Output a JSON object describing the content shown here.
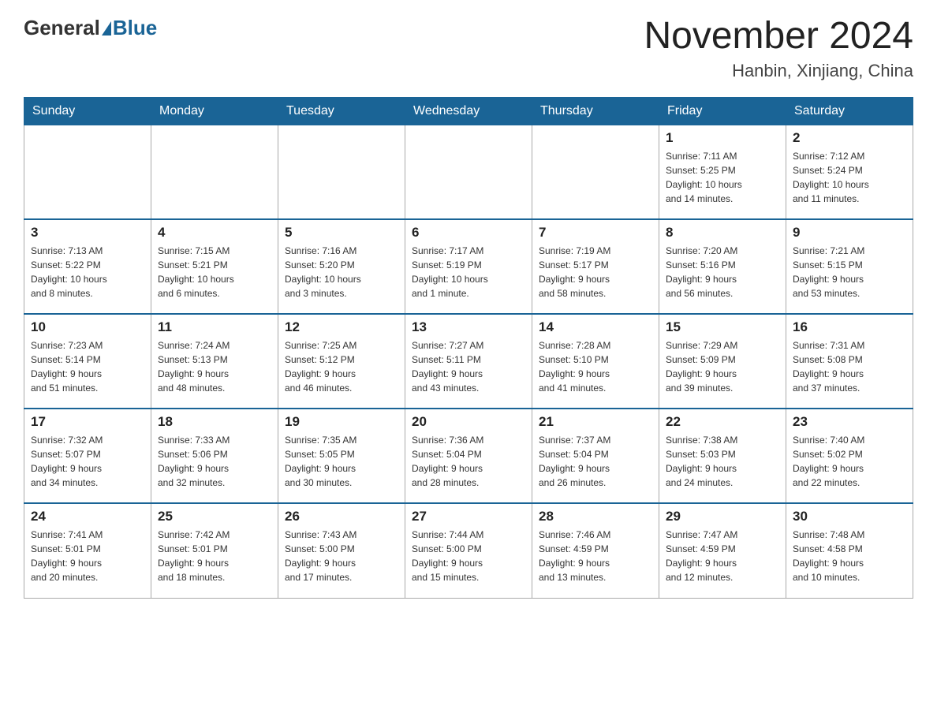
{
  "header": {
    "logo_general": "General",
    "logo_blue": "Blue",
    "month_year": "November 2024",
    "location": "Hanbin, Xinjiang, China"
  },
  "weekdays": [
    "Sunday",
    "Monday",
    "Tuesday",
    "Wednesday",
    "Thursday",
    "Friday",
    "Saturday"
  ],
  "weeks": [
    {
      "days": [
        {
          "num": "",
          "info": ""
        },
        {
          "num": "",
          "info": ""
        },
        {
          "num": "",
          "info": ""
        },
        {
          "num": "",
          "info": ""
        },
        {
          "num": "",
          "info": ""
        },
        {
          "num": "1",
          "info": "Sunrise: 7:11 AM\nSunset: 5:25 PM\nDaylight: 10 hours\nand 14 minutes."
        },
        {
          "num": "2",
          "info": "Sunrise: 7:12 AM\nSunset: 5:24 PM\nDaylight: 10 hours\nand 11 minutes."
        }
      ]
    },
    {
      "days": [
        {
          "num": "3",
          "info": "Sunrise: 7:13 AM\nSunset: 5:22 PM\nDaylight: 10 hours\nand 8 minutes."
        },
        {
          "num": "4",
          "info": "Sunrise: 7:15 AM\nSunset: 5:21 PM\nDaylight: 10 hours\nand 6 minutes."
        },
        {
          "num": "5",
          "info": "Sunrise: 7:16 AM\nSunset: 5:20 PM\nDaylight: 10 hours\nand 3 minutes."
        },
        {
          "num": "6",
          "info": "Sunrise: 7:17 AM\nSunset: 5:19 PM\nDaylight: 10 hours\nand 1 minute."
        },
        {
          "num": "7",
          "info": "Sunrise: 7:19 AM\nSunset: 5:17 PM\nDaylight: 9 hours\nand 58 minutes."
        },
        {
          "num": "8",
          "info": "Sunrise: 7:20 AM\nSunset: 5:16 PM\nDaylight: 9 hours\nand 56 minutes."
        },
        {
          "num": "9",
          "info": "Sunrise: 7:21 AM\nSunset: 5:15 PM\nDaylight: 9 hours\nand 53 minutes."
        }
      ]
    },
    {
      "days": [
        {
          "num": "10",
          "info": "Sunrise: 7:23 AM\nSunset: 5:14 PM\nDaylight: 9 hours\nand 51 minutes."
        },
        {
          "num": "11",
          "info": "Sunrise: 7:24 AM\nSunset: 5:13 PM\nDaylight: 9 hours\nand 48 minutes."
        },
        {
          "num": "12",
          "info": "Sunrise: 7:25 AM\nSunset: 5:12 PM\nDaylight: 9 hours\nand 46 minutes."
        },
        {
          "num": "13",
          "info": "Sunrise: 7:27 AM\nSunset: 5:11 PM\nDaylight: 9 hours\nand 43 minutes."
        },
        {
          "num": "14",
          "info": "Sunrise: 7:28 AM\nSunset: 5:10 PM\nDaylight: 9 hours\nand 41 minutes."
        },
        {
          "num": "15",
          "info": "Sunrise: 7:29 AM\nSunset: 5:09 PM\nDaylight: 9 hours\nand 39 minutes."
        },
        {
          "num": "16",
          "info": "Sunrise: 7:31 AM\nSunset: 5:08 PM\nDaylight: 9 hours\nand 37 minutes."
        }
      ]
    },
    {
      "days": [
        {
          "num": "17",
          "info": "Sunrise: 7:32 AM\nSunset: 5:07 PM\nDaylight: 9 hours\nand 34 minutes."
        },
        {
          "num": "18",
          "info": "Sunrise: 7:33 AM\nSunset: 5:06 PM\nDaylight: 9 hours\nand 32 minutes."
        },
        {
          "num": "19",
          "info": "Sunrise: 7:35 AM\nSunset: 5:05 PM\nDaylight: 9 hours\nand 30 minutes."
        },
        {
          "num": "20",
          "info": "Sunrise: 7:36 AM\nSunset: 5:04 PM\nDaylight: 9 hours\nand 28 minutes."
        },
        {
          "num": "21",
          "info": "Sunrise: 7:37 AM\nSunset: 5:04 PM\nDaylight: 9 hours\nand 26 minutes."
        },
        {
          "num": "22",
          "info": "Sunrise: 7:38 AM\nSunset: 5:03 PM\nDaylight: 9 hours\nand 24 minutes."
        },
        {
          "num": "23",
          "info": "Sunrise: 7:40 AM\nSunset: 5:02 PM\nDaylight: 9 hours\nand 22 minutes."
        }
      ]
    },
    {
      "days": [
        {
          "num": "24",
          "info": "Sunrise: 7:41 AM\nSunset: 5:01 PM\nDaylight: 9 hours\nand 20 minutes."
        },
        {
          "num": "25",
          "info": "Sunrise: 7:42 AM\nSunset: 5:01 PM\nDaylight: 9 hours\nand 18 minutes."
        },
        {
          "num": "26",
          "info": "Sunrise: 7:43 AM\nSunset: 5:00 PM\nDaylight: 9 hours\nand 17 minutes."
        },
        {
          "num": "27",
          "info": "Sunrise: 7:44 AM\nSunset: 5:00 PM\nDaylight: 9 hours\nand 15 minutes."
        },
        {
          "num": "28",
          "info": "Sunrise: 7:46 AM\nSunset: 4:59 PM\nDaylight: 9 hours\nand 13 minutes."
        },
        {
          "num": "29",
          "info": "Sunrise: 7:47 AM\nSunset: 4:59 PM\nDaylight: 9 hours\nand 12 minutes."
        },
        {
          "num": "30",
          "info": "Sunrise: 7:48 AM\nSunset: 4:58 PM\nDaylight: 9 hours\nand 10 minutes."
        }
      ]
    }
  ]
}
